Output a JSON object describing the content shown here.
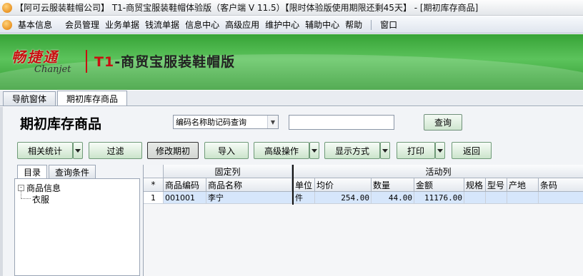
{
  "window": {
    "title": "【阿可云服装鞋帽公司】 T1-商贸宝服装鞋帽体验版（客户端 V 11.5）【限时体验版使用期限还剩45天】 - [期初库存商品]"
  },
  "menu": {
    "items": [
      "基本信息",
      "会员管理",
      "业务单据",
      "钱流单据",
      "信息中心",
      "高级应用",
      "维护中心",
      "辅助中心",
      "帮助",
      "窗口"
    ]
  },
  "banner": {
    "logo_cn": "畅捷通",
    "logo_en": "Chanjet",
    "product_prefix": "T1",
    "product_name": "-商贸宝服装鞋帽版"
  },
  "tabs": [
    "导航窗体",
    "期初库存商品"
  ],
  "page": {
    "title": "期初库存商品",
    "search_mode": "编码名称助记码查询",
    "search_value": "",
    "search_button": "查询"
  },
  "toolbar": {
    "related_stats": "相关统计",
    "filter": "过滤",
    "modify_initial": "修改期初",
    "import": "导入",
    "advanced": "高级操作",
    "display_mode": "显示方式",
    "print": "打印",
    "back": "返回"
  },
  "left_panel": {
    "tabs": [
      "目录",
      "查询条件"
    ],
    "tree_root": "商品信息",
    "tree_toggle": "-",
    "tree_child": "衣服"
  },
  "grid": {
    "group_fixed": "固定列",
    "group_active": "活动列",
    "corner": "*",
    "columns": [
      "商品编码",
      "商品名称",
      "单位",
      "均价",
      "数量",
      "金额",
      "规格",
      "型号",
      "产地",
      "条码"
    ],
    "rows": [
      {
        "no": "1",
        "code": "001001",
        "name": "李宁",
        "unit": "件",
        "avg_price": "254.00",
        "qty": "44.00",
        "amount": "11176.00",
        "spec": "",
        "model": "",
        "origin": "",
        "barcode": ""
      }
    ]
  },
  "colors": {
    "banner_green": "#4bb34b",
    "selected_row": "#d6e6fb",
    "logo_red": "#c81010"
  }
}
